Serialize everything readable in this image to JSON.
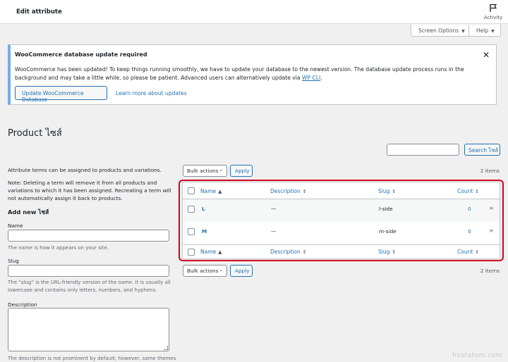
{
  "header": {
    "title": "Edit attribute",
    "activity_label": "Activity"
  },
  "screen_options": {
    "label": "Screen Options",
    "help_label": "Help"
  },
  "notice": {
    "title": "WooCommerce database update required",
    "body": "WooCommerce has been updated! To keep things running smoothly, we have to update your database to the newest version. The database update process runs in the background and may take a little while, so please be patient. Advanced users can alternatively update via ",
    "body_link": "WP CLI",
    "body_end": ".",
    "update_button": "Update WooCommerce Database",
    "learn_more": "Learn more about updates"
  },
  "page": {
    "title": "Product ไซส์"
  },
  "search": {
    "button": "Search ไซส์"
  },
  "left": {
    "intro": "Attribute terms can be assigned to products and variations.",
    "note": "Note: Deleting a term will remove it from all products and variations to which it has been assigned. Recreating a term will not automatically assign it back to products.",
    "add_new_title": "Add new ไซส์",
    "name_label": "Name",
    "name_help": "The name is how it appears on your site.",
    "slug_label": "Slug",
    "slug_help": "The “slug” is the URL-friendly version of the name. It is usually all lowercase and contains only letters, numbers, and hyphens.",
    "description_label": "Description",
    "description_help": "The description is not prominent by default; however, some themes"
  },
  "bulk": {
    "label": "Bulk actions",
    "apply": "Apply",
    "items_count": "2 items"
  },
  "table": {
    "columns": {
      "name": "Name",
      "description": "Description",
      "slug": "Slug",
      "count": "Count"
    },
    "rows": [
      {
        "name": "L",
        "description": "—",
        "slug": "l-side",
        "count": "0"
      },
      {
        "name": "M",
        "description": "—",
        "slug": "m-side",
        "count": "0"
      }
    ]
  },
  "watermark": "hostatom.com",
  "colors": {
    "link": "#2271b1",
    "highlight": "#d0021b",
    "notice_accent": "#72aee6"
  }
}
